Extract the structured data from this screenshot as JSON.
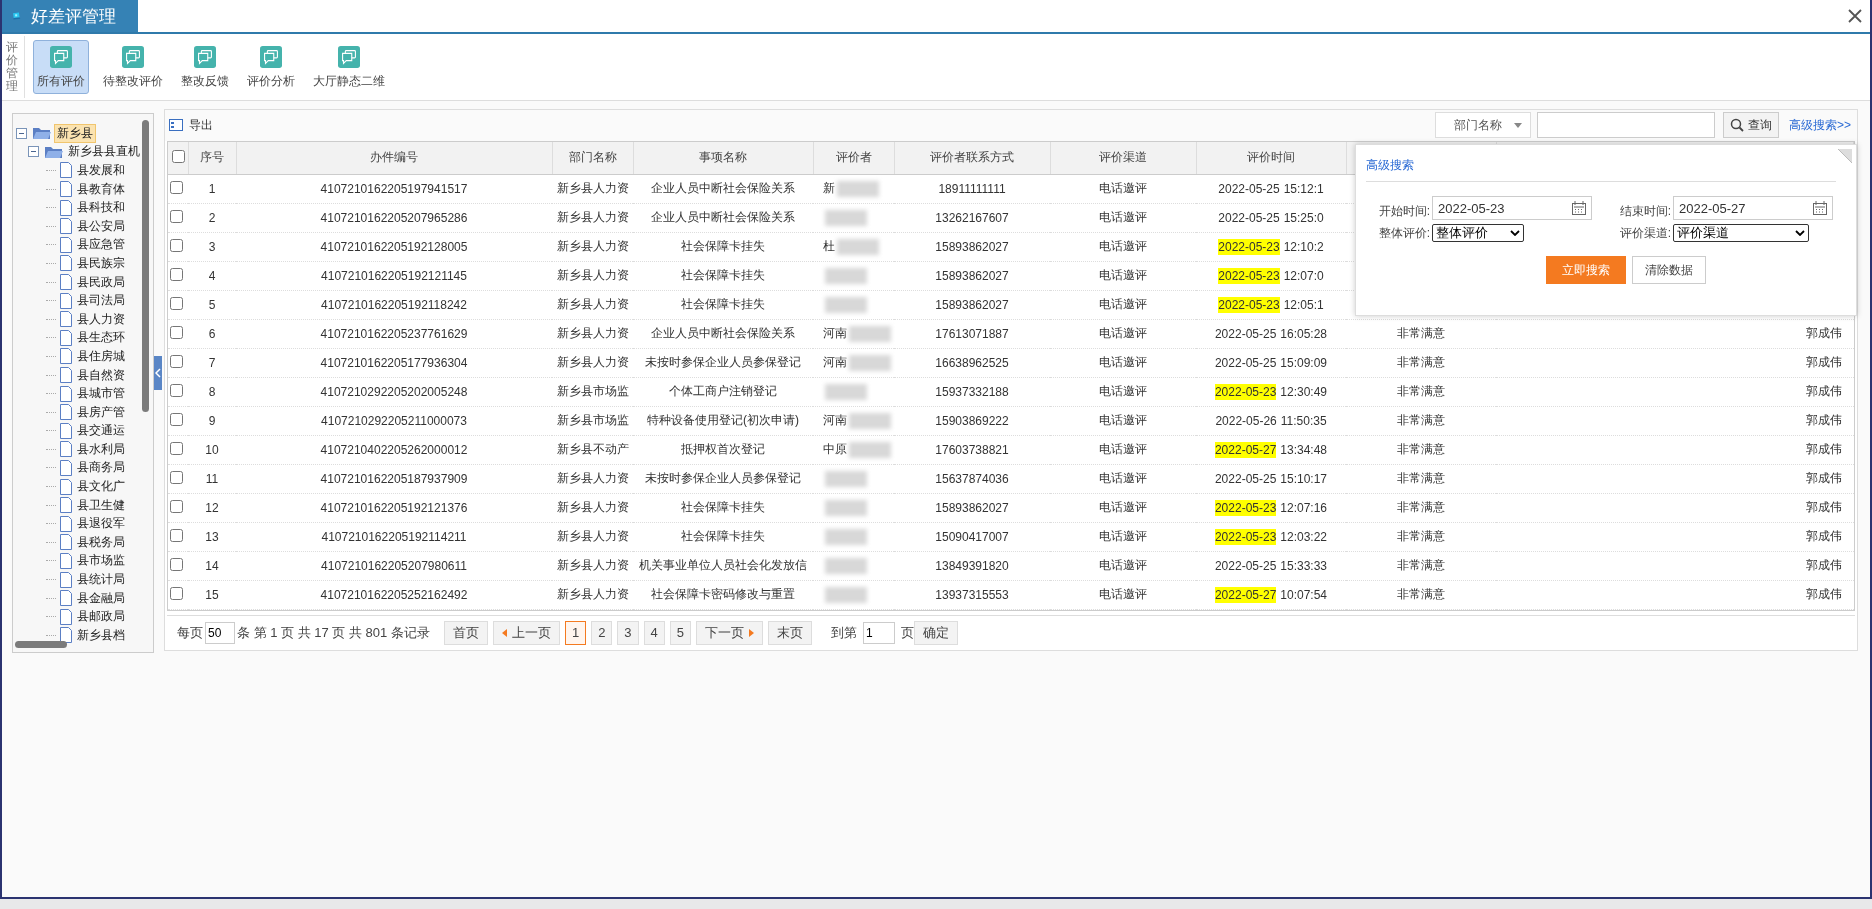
{
  "window": {
    "title": "好差评管理"
  },
  "toolbar": {
    "group_label": "评价管理",
    "items": [
      {
        "label": "所有评价",
        "selected": true
      },
      {
        "label": "待整改评价",
        "selected": false
      },
      {
        "label": "整改反馈",
        "selected": false
      },
      {
        "label": "评价分析",
        "selected": false
      },
      {
        "label": "大厅静态二维",
        "selected": false
      }
    ]
  },
  "tree": {
    "label": "新乡县",
    "selected": true,
    "expanded": true,
    "children": [
      {
        "label": "新乡县县直机",
        "selected": false,
        "expanded": true,
        "children": [
          {
            "label": "县发展和"
          },
          {
            "label": "县教育体"
          },
          {
            "label": "县科技和"
          },
          {
            "label": "县公安局"
          },
          {
            "label": "县应急管"
          },
          {
            "label": "县民族宗"
          },
          {
            "label": "县民政局"
          },
          {
            "label": "县司法局"
          },
          {
            "label": "县人力资"
          },
          {
            "label": "县生态环"
          },
          {
            "label": "县住房城"
          },
          {
            "label": "县自然资"
          },
          {
            "label": "县城市管"
          },
          {
            "label": "县房产管"
          },
          {
            "label": "县交通运"
          },
          {
            "label": "县水利局"
          },
          {
            "label": "县商务局"
          },
          {
            "label": "县文化广"
          },
          {
            "label": "县卫生健"
          },
          {
            "label": "县退役军"
          },
          {
            "label": "县税务局"
          },
          {
            "label": "县市场监"
          },
          {
            "label": "县统计局"
          },
          {
            "label": "县金融局"
          },
          {
            "label": "县邮政局"
          },
          {
            "label": "新乡县档"
          }
        ]
      }
    ]
  },
  "grid_toolbar": {
    "export": "导出",
    "filter_field": "部门名称",
    "search_button": "查询",
    "advanced_link": "高级搜索>>"
  },
  "table": {
    "all_checked": false,
    "columns": [
      "序号",
      "办件编号",
      "部门名称",
      "事项名称",
      "评价者",
      "评价者联系方式",
      "评价渠道",
      "评价时间"
    ],
    "rows": [
      {
        "checked": false,
        "no": "1",
        "id": "4107210162205197941517",
        "dept": "新乡县人力资",
        "item": "企业人员中断社会保险关系",
        "evaluator": "新",
        "phone": "18911111111",
        "channel": "电话邀评",
        "date": "2022-05-25",
        "highlight": false,
        "time": "15:12:1"
      },
      {
        "checked": false,
        "no": "2",
        "id": "4107210162205207965286",
        "dept": "新乡县人力资",
        "item": "企业人员中断社会保险关系",
        "phone": "13262167607",
        "channel": "电话邀评",
        "date": "2022-05-25",
        "highlight": false,
        "time": "15:25:0"
      },
      {
        "checked": false,
        "no": "3",
        "id": "4107210162205192128005",
        "dept": "新乡县人力资",
        "item": "社会保障卡挂失",
        "evaluator": "杜",
        "phone": "15893862027",
        "channel": "电话邀评",
        "date": "2022-05-23",
        "highlight": true,
        "time": "12:10:2"
      },
      {
        "checked": false,
        "no": "4",
        "id": "4107210162205192121145",
        "dept": "新乡县人力资",
        "item": "社会保障卡挂失",
        "phone": "15893862027",
        "channel": "电话邀评",
        "date": "2022-05-23",
        "highlight": true,
        "time": "12:07:0"
      },
      {
        "checked": false,
        "no": "5",
        "id": "4107210162205192118242",
        "dept": "新乡县人力资",
        "item": "社会保障卡挂失",
        "phone": "15893862027",
        "channel": "电话邀评",
        "date": "2022-05-23",
        "highlight": true,
        "time": "12:05:1"
      },
      {
        "checked": false,
        "no": "6",
        "id": "4107210162205237761629",
        "dept": "新乡县人力资",
        "item": "企业人员中断社会保险关系",
        "evaluator": "河南",
        "phone": "17613071887",
        "channel": "电话邀评",
        "date": "2022-05-25",
        "highlight": false,
        "time": "16:05:28",
        "rating": "非常满意",
        "handler": "郭成伟"
      },
      {
        "checked": false,
        "no": "7",
        "id": "4107210162205177936304",
        "dept": "新乡县人力资",
        "item": "未按时参保企业人员参保登记",
        "evaluator": "河南",
        "phone": "16638962525",
        "channel": "电话邀评",
        "date": "2022-05-25",
        "highlight": false,
        "time": "15:09:09",
        "rating": "非常满意",
        "handler": "郭成伟"
      },
      {
        "checked": false,
        "no": "8",
        "id": "4107210292205202005248",
        "dept": "新乡县市场监",
        "item": "个体工商户注销登记",
        "phone": "15937332188",
        "channel": "电话邀评",
        "date": "2022-05-23",
        "highlight": true,
        "time": "12:30:49",
        "rating": "非常满意",
        "handler": "郭成伟"
      },
      {
        "checked": false,
        "no": "9",
        "id": "4107210292205211000073",
        "dept": "新乡县市场监",
        "item": "特种设备使用登记(初次申请)",
        "evaluator": "河南",
        "phone": "15903869222",
        "channel": "电话邀评",
        "date": "2022-05-26",
        "highlight": false,
        "time": "11:50:35",
        "rating": "非常满意",
        "handler": "郭成伟"
      },
      {
        "checked": false,
        "no": "10",
        "id": "4107210402205262000012",
        "dept": "新乡县不动产",
        "item": "抵押权首次登记",
        "evaluator": "中原",
        "phone": "17603738821",
        "channel": "电话邀评",
        "date": "2022-05-27",
        "highlight": true,
        "time": "13:34:48",
        "rating": "非常满意",
        "handler": "郭成伟"
      },
      {
        "checked": false,
        "no": "11",
        "id": "4107210162205187937909",
        "dept": "新乡县人力资",
        "item": "未按时参保企业人员参保登记",
        "phone": "15637874036",
        "channel": "电话邀评",
        "date": "2022-05-25",
        "highlight": false,
        "time": "15:10:17",
        "rating": "非常满意",
        "handler": "郭成伟"
      },
      {
        "checked": false,
        "no": "12",
        "id": "4107210162205192121376",
        "dept": "新乡县人力资",
        "item": "社会保障卡挂失",
        "phone": "15893862027",
        "channel": "电话邀评",
        "date": "2022-05-23",
        "highlight": true,
        "time": "12:07:16",
        "rating": "非常满意",
        "handler": "郭成伟"
      },
      {
        "checked": false,
        "no": "13",
        "id": "4107210162205192114211",
        "dept": "新乡县人力资",
        "item": "社会保障卡挂失",
        "phone": "15090417007",
        "channel": "电话邀评",
        "date": "2022-05-23",
        "highlight": true,
        "time": "12:03:22",
        "rating": "非常满意",
        "handler": "郭成伟"
      },
      {
        "checked": false,
        "no": "14",
        "id": "4107210162205207980611",
        "dept": "新乡县人力资",
        "item": "机关事业单位人员社会化发放信",
        "phone": "13849391820",
        "channel": "电话邀评",
        "date": "2022-05-25",
        "highlight": false,
        "time": "15:33:33",
        "rating": "非常满意",
        "handler": "郭成伟"
      },
      {
        "checked": false,
        "no": "15",
        "id": "4107210162205252162492",
        "dept": "新乡县人力资",
        "item": "社会保障卡密码修改与重置",
        "phone": "13937315553",
        "channel": "电话邀评",
        "date": "2022-05-27",
        "highlight": true,
        "time": "10:07:54",
        "rating": "非常满意",
        "handler": "郭成伟"
      }
    ]
  },
  "pagination": {
    "per_page_label": "每页",
    "per_page": "50",
    "summary": "条 第 1 页 共 17 页 共 801 条记录",
    "first": "首页",
    "prev": "上一页",
    "pages": [
      {
        "label": "1",
        "selected": true
      },
      {
        "label": "2",
        "selected": false
      },
      {
        "label": "3",
        "selected": false
      },
      {
        "label": "4",
        "selected": false
      },
      {
        "label": "5",
        "selected": false
      }
    ],
    "next": "下一页",
    "last": "末页",
    "goto_label": "到第",
    "goto_value": "1",
    "goto_unit": "页",
    "confirm": "确定"
  },
  "advanced_search": {
    "title": "高级搜索",
    "fields": [
      {
        "kind": "date",
        "label": "开始时间:",
        "value": "2022-05-23"
      },
      {
        "kind": "date",
        "label": "结束时间:",
        "value": "2022-05-27"
      },
      {
        "kind": "select",
        "label": "整体评价:",
        "value": "整体评价"
      },
      {
        "kind": "select",
        "label": "评价渠道:",
        "value": "评价渠道"
      }
    ],
    "search_button": "立即搜索",
    "clear_button": "清除数据"
  }
}
